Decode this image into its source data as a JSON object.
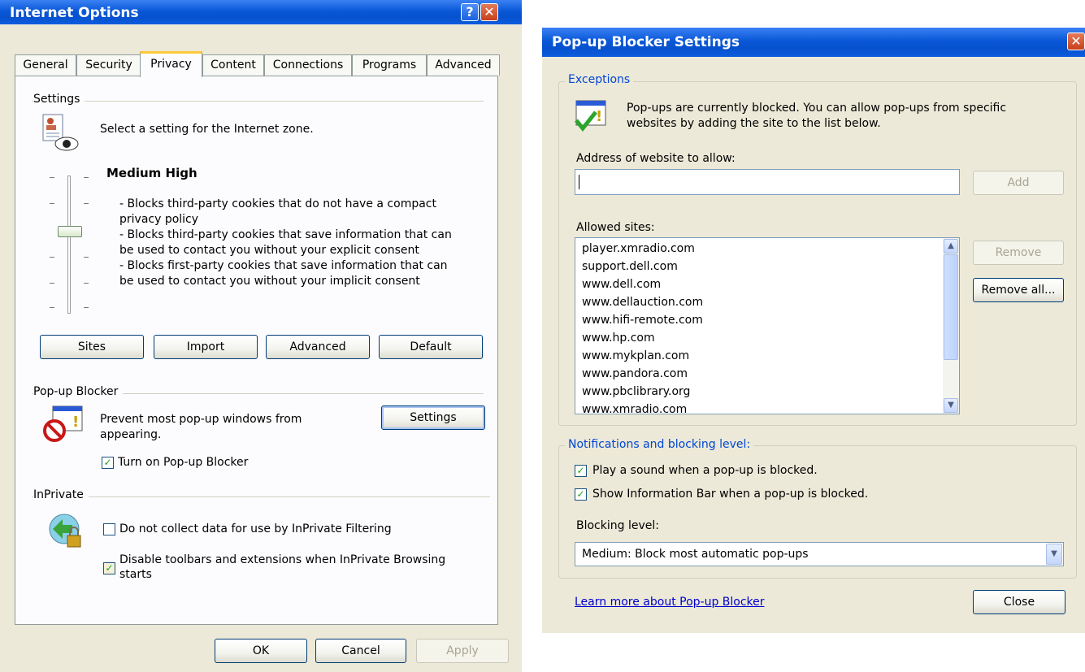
{
  "internet_options": {
    "title": "Internet Options",
    "help_btn": "?",
    "close_btn": "✕",
    "tabs": [
      "General",
      "Security",
      "Privacy",
      "Content",
      "Connections",
      "Programs",
      "Advanced"
    ],
    "active_tab": "Privacy",
    "settings": {
      "group_label": "Settings",
      "description": "Select a setting for the Internet zone.",
      "level_name": "Medium High",
      "details": [
        "- Blocks third-party cookies that do not have a compact",
        "privacy policy",
        "- Blocks third-party cookies that save information that can",
        "be used to contact you without your explicit consent",
        "- Blocks first-party cookies that save information that can",
        "be used to contact you without your implicit consent"
      ],
      "buttons": [
        "Sites",
        "Import",
        "Advanced",
        "Default"
      ]
    },
    "popup_blocker": {
      "group_label": "Pop-up Blocker",
      "description_line1": "Prevent most pop-up windows from",
      "description_line2": "appearing.",
      "settings_button": "Settings",
      "checkbox_label": "Turn on Pop-up Blocker",
      "checkbox_checked": true
    },
    "inprivate": {
      "group_label": "InPrivate",
      "checkbox1_label": "Do not collect data for use by InPrivate Filtering",
      "checkbox1_checked": false,
      "checkbox2_label_line1": "Disable toolbars and extensions when InPrivate Browsing",
      "checkbox2_label_line2": "starts",
      "checkbox2_checked": true
    },
    "footer": {
      "ok": "OK",
      "cancel": "Cancel",
      "apply": "Apply"
    }
  },
  "popup_settings": {
    "title": "Pop-up Blocker Settings",
    "close_btn": "✕",
    "exceptions": {
      "group_label": "Exceptions",
      "info_line1": "Pop-ups are currently blocked.  You can allow pop-ups from specific",
      "info_line2": "websites by adding the site to the list below.",
      "address_label": "Address of website to allow:",
      "address_value": "",
      "add_button": "Add",
      "allowed_label": "Allowed sites:",
      "allowed_sites": [
        "player.xmradio.com",
        "support.dell.com",
        "www.dell.com",
        "www.dellauction.com",
        "www.hifi-remote.com",
        "www.hp.com",
        "www.mykplan.com",
        "www.pandora.com",
        "www.pbclibrary.org",
        "www.xmradio.com"
      ],
      "remove_button": "Remove",
      "remove_all_button": "Remove all..."
    },
    "notifications": {
      "group_label": "Notifications and blocking level:",
      "play_sound_label": "Play a sound when a pop-up is blocked.",
      "play_sound_checked": true,
      "info_bar_label": "Show Information Bar when a pop-up is blocked.",
      "info_bar_checked": true,
      "blocking_level_label": "Blocking level:",
      "blocking_level_value": "Medium: Block most automatic pop-ups"
    },
    "learn_more_link": "Learn more about Pop-up Blocker",
    "close_button": "Close"
  }
}
